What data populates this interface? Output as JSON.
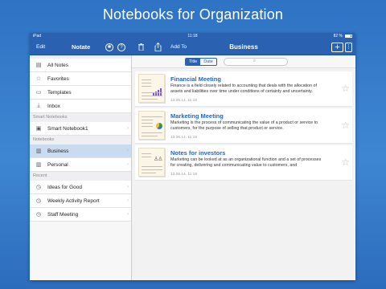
{
  "headline": "Notebooks for Organization",
  "status": {
    "device": "iPad",
    "time": "11:18",
    "battery": "82 %"
  },
  "toolbar": {
    "edit_label": "Edit",
    "app_name": "Notate",
    "settings_icon": "gear-icon",
    "help_label": "?",
    "add_to_label": "Add To",
    "notebook_title": "Business",
    "add_label": "+",
    "more_label": "⋮"
  },
  "sidebar": {
    "top_items": [
      {
        "label": "All Notes",
        "icon": "notes-icon"
      },
      {
        "label": "Favorites",
        "icon": "star-icon"
      },
      {
        "label": "Templates",
        "icon": "templates-icon"
      },
      {
        "label": "Inbox",
        "icon": "inbox-icon"
      }
    ],
    "smart_section": "Smart Notebooks",
    "smart_items": [
      {
        "label": "Smart Notebook1",
        "icon": "smart-notebook-icon"
      }
    ],
    "notebooks_section": "Notebooks",
    "notebook_items": [
      {
        "label": "Business",
        "icon": "notebook-icon",
        "selected": true
      },
      {
        "label": "Personal",
        "icon": "notebook-icon"
      }
    ],
    "recent_section": "Recent",
    "recent_items": [
      {
        "label": "Ideas for Good",
        "icon": "clock-icon"
      },
      {
        "label": "Weekly Activity Report",
        "icon": "clock-icon"
      },
      {
        "label": "Staff Meeting",
        "icon": "clock-icon"
      }
    ]
  },
  "main": {
    "seg_title": "Title",
    "seg_date": "Date",
    "notes": [
      {
        "title": "Financial Meeting",
        "desc": "Finance is a field closely related to accounting that deals with the allocation of assets and liabilities over time under conditions of certainty and uncertainty.",
        "date": "13.06.14, 11:18"
      },
      {
        "title": "Marketing Meeting",
        "desc": "Marketing is the process of communicating the value of a product or service to customers, for the purpose of selling that product or service.",
        "date": "13.06.14, 11:18"
      },
      {
        "title": "Notes for investors",
        "desc": "Marketing can be looked at as an organizational function and a set of processes for creating, delivering and communicating value to customers, and",
        "date": "13.06.14, 11:18"
      }
    ]
  },
  "colors": {
    "accent": "#2a61b0",
    "title_blue": "#2366c2",
    "selected_bg": "#c9dbef",
    "background": "#3a80cf"
  }
}
